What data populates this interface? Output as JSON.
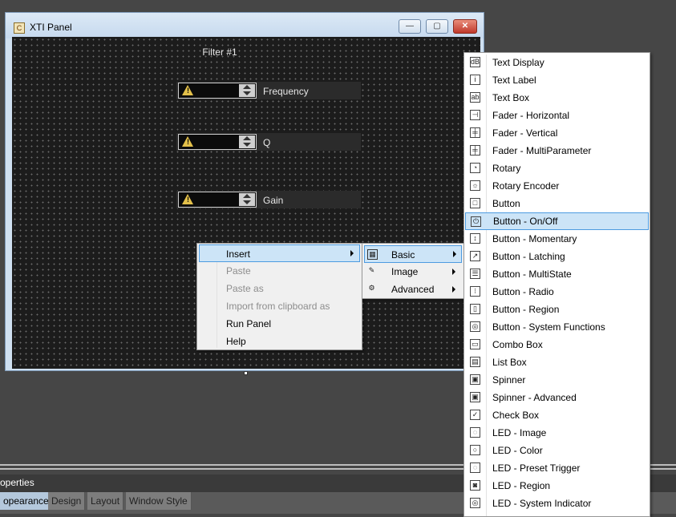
{
  "window": {
    "title": "XTI Panel",
    "minimize": "—",
    "maximize": "▢",
    "close": "✕",
    "icon": "app-icon"
  },
  "panel": {
    "group_title": "Filter #1",
    "controls": [
      {
        "label": "Frequency",
        "icon": "warning-icon"
      },
      {
        "label": "Q",
        "icon": "warning-icon"
      },
      {
        "label": "Gain",
        "icon": "warning-icon"
      }
    ]
  },
  "context_menu": {
    "items": [
      {
        "label": "Insert",
        "enabled": true,
        "submenu": true
      },
      {
        "label": "Paste",
        "enabled": false
      },
      {
        "label": "Paste as",
        "enabled": false
      },
      {
        "label": "Import from clipboard as",
        "enabled": false
      },
      {
        "label": "Run Panel",
        "enabled": true
      },
      {
        "label": "Help",
        "enabled": true
      }
    ]
  },
  "insert_menu": {
    "items": [
      {
        "label": "Basic",
        "icon": "basic-controls-icon"
      },
      {
        "label": "Image",
        "icon": "image-icon"
      },
      {
        "label": "Advanced",
        "icon": "advanced-gear-icon"
      }
    ]
  },
  "basic_menu": {
    "items": [
      {
        "label": "Text Display",
        "icon": "text-display-icon",
        "glyph": "dB"
      },
      {
        "label": "Text Label",
        "icon": "text-label-icon",
        "glyph": "i"
      },
      {
        "label": "Text Box",
        "icon": "text-box-icon",
        "glyph": "ab"
      },
      {
        "label": "Fader - Horizontal",
        "icon": "fader-horizontal-icon",
        "glyph": "⊣"
      },
      {
        "label": "Fader - Vertical",
        "icon": "fader-vertical-icon",
        "glyph": "╪"
      },
      {
        "label": "Fader - MultiParameter",
        "icon": "fader-multiparameter-icon",
        "glyph": "╪"
      },
      {
        "label": "Rotary",
        "icon": "rotary-icon",
        "glyph": "◔"
      },
      {
        "label": "Rotary Encoder",
        "icon": "rotary-encoder-icon",
        "glyph": "☼"
      },
      {
        "label": "Button",
        "icon": "button-icon",
        "glyph": "□"
      },
      {
        "label": "Button - On/Off",
        "icon": "power-icon",
        "glyph": "⏻"
      },
      {
        "label": "Button - Momentary",
        "icon": "button-momentary-icon",
        "glyph": "↕"
      },
      {
        "label": "Button - Latching",
        "icon": "button-latching-icon",
        "glyph": "↗"
      },
      {
        "label": "Button - MultiState",
        "icon": "button-multistate-icon",
        "glyph": "☰"
      },
      {
        "label": "Button - Radio",
        "icon": "button-radio-icon",
        "glyph": "⁝"
      },
      {
        "label": "Button - Region",
        "icon": "button-region-icon",
        "glyph": "▯"
      },
      {
        "label": "Button - System Functions",
        "icon": "button-system-functions-icon",
        "glyph": "◎"
      },
      {
        "label": "Combo Box",
        "icon": "combo-box-icon",
        "glyph": "▭"
      },
      {
        "label": "List Box",
        "icon": "list-box-icon",
        "glyph": "▤"
      },
      {
        "label": "Spinner",
        "icon": "spinner-icon",
        "glyph": "▣"
      },
      {
        "label": "Spinner - Advanced",
        "icon": "spinner-advanced-icon",
        "glyph": "▣"
      },
      {
        "label": "Check Box",
        "icon": "check-box-icon",
        "glyph": "✓"
      },
      {
        "label": "LED - Image",
        "icon": "led-image-icon",
        "glyph": "◌"
      },
      {
        "label": "LED - Color",
        "icon": "led-color-icon",
        "glyph": "○"
      },
      {
        "label": "LED - Preset Trigger",
        "icon": "led-preset-trigger-icon",
        "glyph": "◌"
      },
      {
        "label": "LED - Region",
        "icon": "led-region-icon",
        "glyph": "◙"
      },
      {
        "label": "LED - System Indicator",
        "icon": "led-system-indicator-icon",
        "glyph": "◎"
      }
    ]
  },
  "properties": {
    "title": "operties",
    "tabs": [
      "opearance",
      "Design",
      "Layout",
      "Window Style"
    ]
  },
  "colors": {
    "highlight": "#cce4f7",
    "highlight_border": "#4d9be0",
    "desktop": "#464646",
    "panel_bg": "#1c1c1c"
  }
}
